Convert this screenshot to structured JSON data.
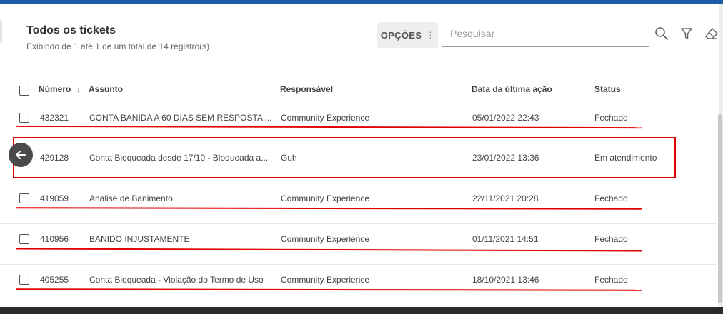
{
  "header": {
    "title": "Todos os tickets",
    "subtitle": "Exibindo de 1 até 1 de um total de 14 registro(s)"
  },
  "toolbar": {
    "options_label": "OPÇÕES",
    "options_dots": "⋮",
    "search_placeholder": "Pesquisar"
  },
  "icons": [
    "search-icon",
    "filter-icon",
    "eraser-icon",
    "back-arrow-icon",
    "sort-down-icon"
  ],
  "colors": {
    "accent_bar": "#1f5aa6",
    "annotation_red": "#e00000"
  },
  "table": {
    "columns": {
      "numero": "Número",
      "sort_arrow": "↓",
      "assunto": "Assunto",
      "responsavel": "Responsável",
      "data": "Data da última ação",
      "status": "Status"
    },
    "rows": [
      {
        "numero": "432321",
        "assunto": "CONTA BANIDA A 60 DIAS SEM RESPOSTA ...",
        "responsavel": "Community Experience",
        "data": "05/01/2022 22:43",
        "status": "Fechado"
      },
      {
        "numero": "429128",
        "assunto": "Conta Bloqueada desde 17/10 - Bloqueada a...",
        "responsavel": "Guh",
        "data": "23/01/2022 13:36",
        "status": "Em atendimento"
      },
      {
        "numero": "419059",
        "assunto": "Analise de Banimento",
        "responsavel": "Community Experience",
        "data": "22/11/2021 20:28",
        "status": "Fechado"
      },
      {
        "numero": "410956",
        "assunto": "BANIDO INJUSTAMENTE",
        "responsavel": "Community Experience",
        "data": "01/11/2021 14:51",
        "status": "Fechado"
      },
      {
        "numero": "405255",
        "assunto": "Conta Bloqueada - Violação do Termo de Uso",
        "responsavel": "Community Experience",
        "data": "18/10/2021 13:46",
        "status": "Fechado"
      }
    ]
  }
}
